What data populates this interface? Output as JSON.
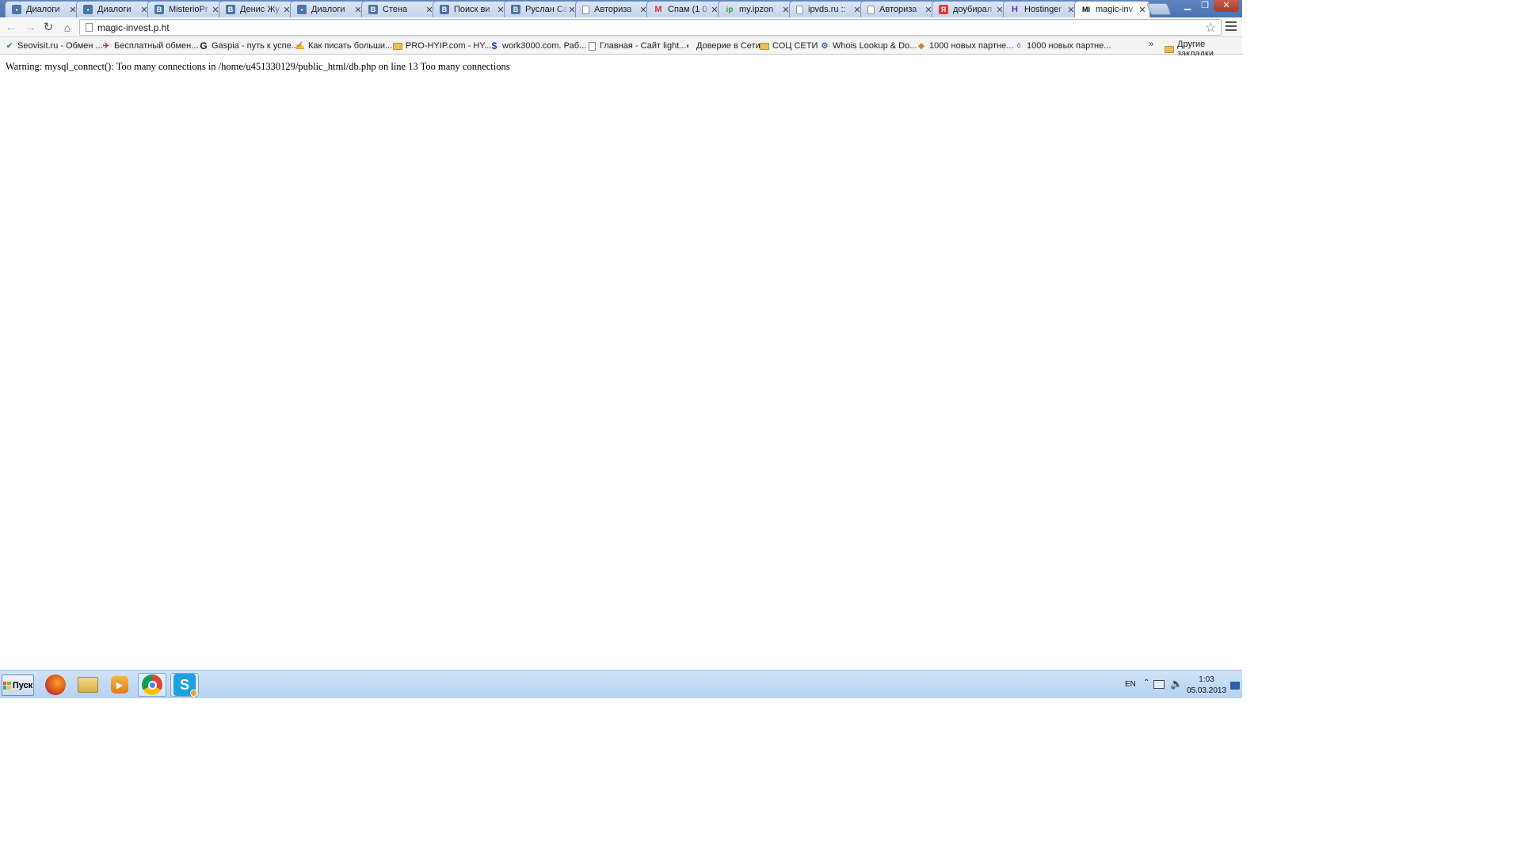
{
  "tabs": [
    {
      "title": "Диалоги",
      "icon": "chat-icon",
      "active": false
    },
    {
      "title": "Диалоги",
      "icon": "chat-icon",
      "active": false
    },
    {
      "title": "MisterioPr",
      "icon": "vk-icon",
      "active": false
    },
    {
      "title": "Денис Жу",
      "icon": "vk-icon",
      "active": false
    },
    {
      "title": "Диалоги",
      "icon": "chat-icon",
      "active": false
    },
    {
      "title": "Стена",
      "icon": "vk-icon",
      "active": false
    },
    {
      "title": "Поиск ви",
      "icon": "vk-icon",
      "active": false
    },
    {
      "title": "Руслан Са",
      "icon": "vk-icon",
      "active": false
    },
    {
      "title": "Авториза",
      "icon": "page-icon",
      "active": false
    },
    {
      "title": "Спам (1 0",
      "icon": "gmail-icon",
      "active": false
    },
    {
      "title": "my.ipzon",
      "icon": "ipzone-icon",
      "active": false
    },
    {
      "title": "ipvds.ru ::",
      "icon": "page-icon",
      "active": false
    },
    {
      "title": "Авториза",
      "icon": "page-icon",
      "active": false
    },
    {
      "title": "доубирал",
      "icon": "yandex-icon",
      "active": false
    },
    {
      "title": "Hostinger",
      "icon": "hostinger-icon",
      "active": false
    },
    {
      "title": "magic-inv",
      "icon": "mi-icon",
      "active": true
    }
  ],
  "toolbar": {
    "url": "magic-invest.p.ht"
  },
  "bookmarks": [
    {
      "label": "Seovisit.ru - Обмен ...",
      "icon": "check-icon"
    },
    {
      "label": "Бесплатный обмен...",
      "icon": "plane-icon"
    },
    {
      "label": "Gaspia - путь к успе...",
      "icon": "g-icon"
    },
    {
      "label": "Как писать больши...",
      "icon": "hand-icon"
    },
    {
      "label": "PRO-HYIP.com - HY...",
      "icon": "pro-icon"
    },
    {
      "label": "work3000.com. Раб...",
      "icon": "dollar-icon"
    },
    {
      "label": "Главная - Сайт light...",
      "icon": "page-icon"
    },
    {
      "label": "Доверие в Сети",
      "icon": "shield-icon"
    },
    {
      "label": "СОЦ СЕТИ",
      "icon": "folder-icon"
    },
    {
      "label": "Whois Lookup & Do...",
      "icon": "whois-icon"
    },
    {
      "label": "1000 новых партне...",
      "icon": "gold-icon"
    },
    {
      "label": "1000 новых партне...",
      "icon": "diamond-icon"
    }
  ],
  "bookmarks_more": "»",
  "bookmarks_other": "Другие закладки",
  "page": {
    "warning": "Warning: mysql_connect(): Too many connections in /home/u451330129/public_html/db.php on line 13 Too many connections"
  },
  "taskbar": {
    "start_label": "Пуск",
    "language": "EN",
    "time": "1:03",
    "date": "05.03.2013"
  }
}
